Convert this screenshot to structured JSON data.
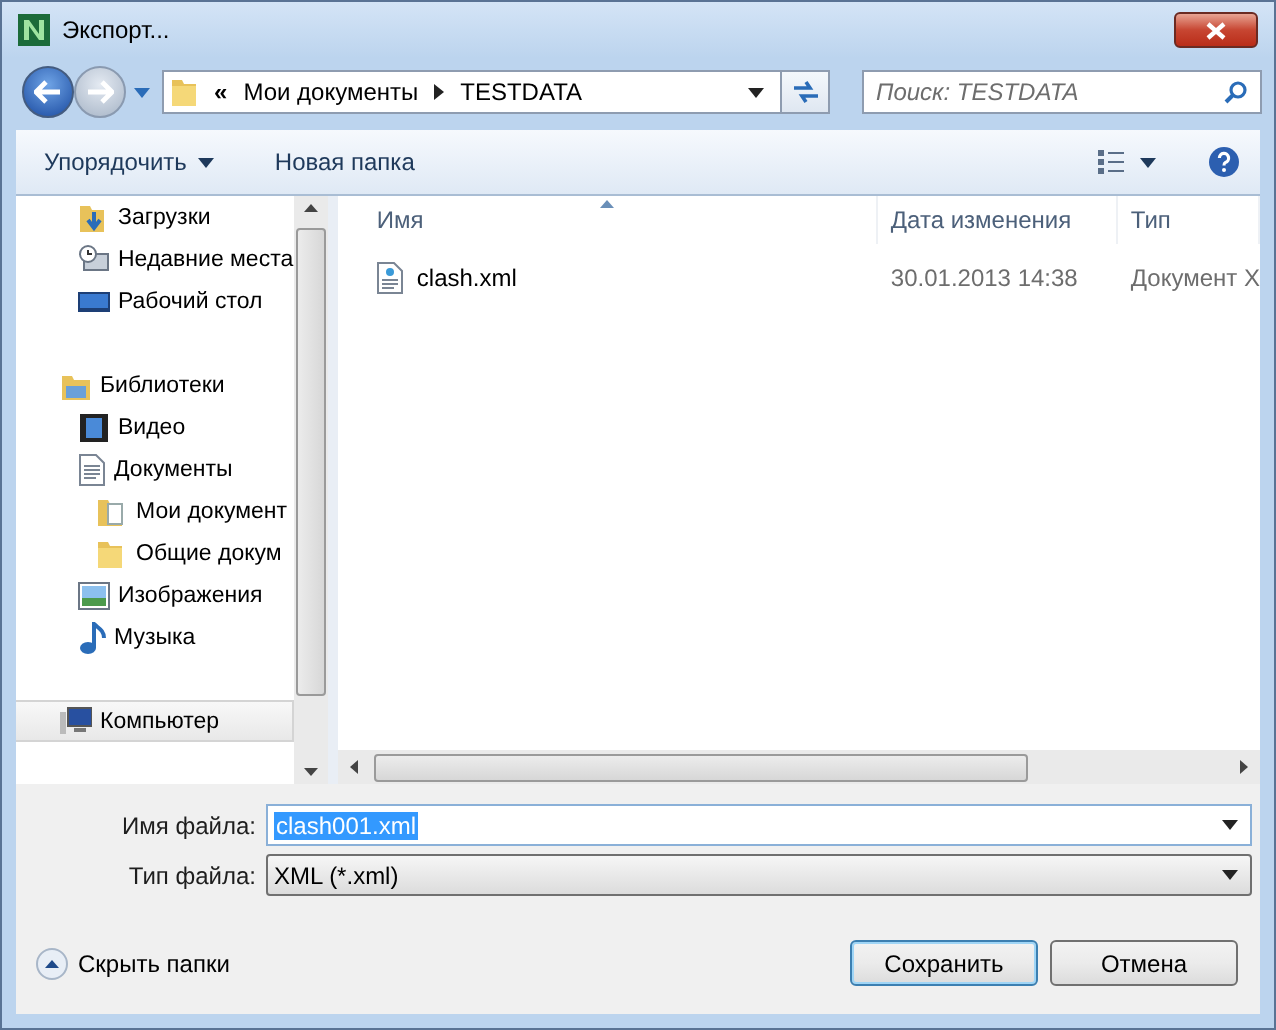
{
  "window": {
    "title": "Экспорт..."
  },
  "nav": {
    "overflow": "«",
    "path": [
      "Мои документы",
      "TESTDATA"
    ],
    "search": {
      "placeholder": "Поиск: TESTDATA"
    }
  },
  "toolbar": {
    "organize": "Упорядочить",
    "new_folder": "Новая папка"
  },
  "sidebar": {
    "groups": [
      {
        "items": [
          {
            "label": "Загрузки",
            "selected": false
          },
          {
            "label": "Недавние места",
            "selected": false
          },
          {
            "label": "Рабочий стол",
            "selected": false
          }
        ]
      },
      {
        "items": [
          {
            "label": "Библиотеки",
            "selected": false,
            "children": [
              {
                "label": "Видео",
                "selected": false
              },
              {
                "label": "Документы",
                "selected": false,
                "children": [
                  {
                    "label": "Мои документ",
                    "selected": false
                  },
                  {
                    "label": "Общие докум",
                    "selected": false
                  }
                ]
              },
              {
                "label": "Изображения",
                "selected": false
              },
              {
                "label": "Музыка",
                "selected": false
              }
            ]
          }
        ]
      },
      {
        "items": [
          {
            "label": "Компьютер",
            "selected": true
          }
        ]
      }
    ]
  },
  "file_list": {
    "columns": [
      "Имя",
      "Дата изменения",
      "Тип"
    ],
    "rows": [
      {
        "name": "clash.xml",
        "date": "30.01.2013 14:38",
        "type": "Документ X",
        "selected": false
      }
    ]
  },
  "file_name": {
    "label": "Имя файла:",
    "value": "clash001.xml",
    "value_selected": true
  },
  "file_type": {
    "label": "Тип файла:",
    "value": "XML (*.xml)"
  },
  "hide_folders": "Скрыть папки",
  "buttons": [
    {
      "label": "Сохранить",
      "default": true
    },
    {
      "label": "Отмена",
      "default": false
    }
  ]
}
